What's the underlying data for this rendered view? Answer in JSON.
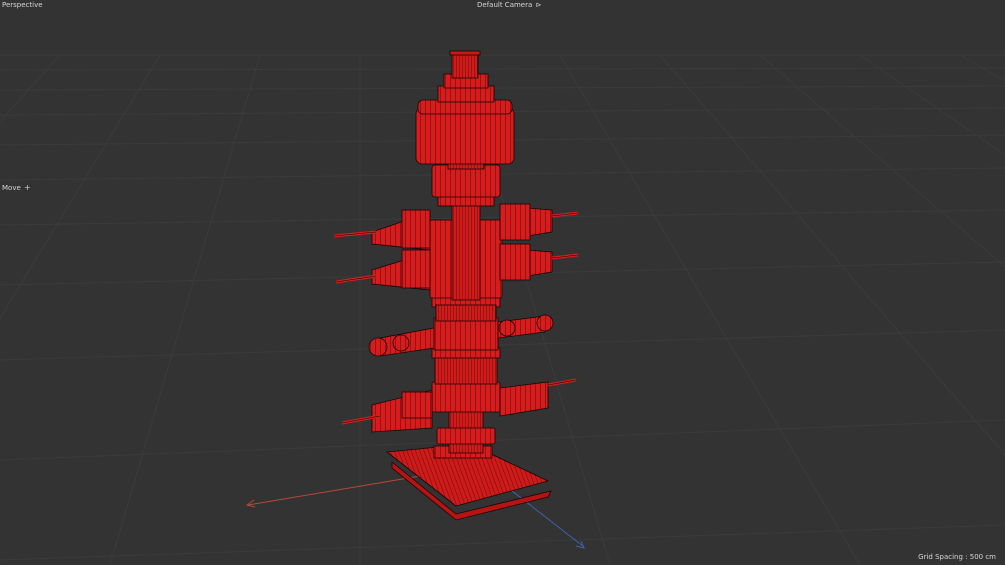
{
  "viewport": {
    "view_name": "Perspective",
    "camera_name": "Default Camera",
    "camera_icon": "camera-icon",
    "active_tool": "Move",
    "active_tool_icon": "move-crosshair-icon",
    "grid_spacing_label": "Grid Spacing : 500 cm"
  },
  "colors": {
    "background": "#333333",
    "grid_line": "#3d3d3d",
    "model_fill": "#d61c1c",
    "model_wire": "#1a0505",
    "x_axis": "#b44a3a",
    "z_axis": "#3e63a8"
  },
  "scene": {
    "object": "wellhead-christmas-tree-model",
    "display_mode": "wireframe-shaded"
  }
}
